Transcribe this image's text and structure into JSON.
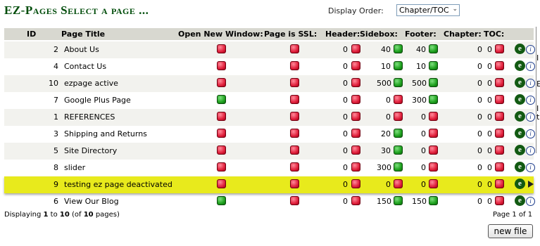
{
  "page_title": "EZ-Pages Select a page ...",
  "display_order": {
    "label": "Display Order:",
    "selected": "Chapter/TOC"
  },
  "columns": {
    "id": "ID",
    "page_title": "Page Title",
    "open_new_window": "Open New Window:",
    "page_is_ssl": "Page is SSL:",
    "header": "Header:",
    "sidebox": "Sidebox:",
    "footer": "Footer:",
    "chapter": "Chapter:",
    "toc": "TOC:"
  },
  "rows": [
    {
      "id": "2",
      "title": "About Us",
      "new_window": "red",
      "ssl": "red",
      "header_val": "0",
      "header": "red",
      "sidebox_val": "40",
      "sidebox": "green",
      "footer_val": "40",
      "footer": "green",
      "chapter": "0",
      "toc_val": "0",
      "toc": "red"
    },
    {
      "id": "4",
      "title": "Contact Us",
      "new_window": "red",
      "ssl": "red",
      "header_val": "0",
      "header": "red",
      "sidebox_val": "10",
      "sidebox": "green",
      "footer_val": "10",
      "footer": "green",
      "chapter": "0",
      "toc_val": "0",
      "toc": "red"
    },
    {
      "id": "10",
      "title": "ezpage active",
      "new_window": "red",
      "ssl": "red",
      "header_val": "0",
      "header": "red",
      "sidebox_val": "500",
      "sidebox": "green",
      "footer_val": "500",
      "footer": "green",
      "chapter": "0",
      "toc_val": "0",
      "toc": "red"
    },
    {
      "id": "7",
      "title": "Google Plus Page",
      "new_window": "green",
      "ssl": "red",
      "header_val": "0",
      "header": "red",
      "sidebox_val": "0",
      "sidebox": "red",
      "footer_val": "300",
      "footer": "green",
      "chapter": "0",
      "toc_val": "0",
      "toc": "red"
    },
    {
      "id": "1",
      "title": "REFERENCES",
      "new_window": "red",
      "ssl": "red",
      "header_val": "0",
      "header": "red",
      "sidebox_val": "0",
      "sidebox": "red",
      "footer_val": "0",
      "footer": "red",
      "chapter": "0",
      "toc_val": "0",
      "toc": "red"
    },
    {
      "id": "3",
      "title": "Shipping and Returns",
      "new_window": "red",
      "ssl": "red",
      "header_val": "0",
      "header": "red",
      "sidebox_val": "20",
      "sidebox": "green",
      "footer_val": "0",
      "footer": "red",
      "chapter": "0",
      "toc_val": "0",
      "toc": "red"
    },
    {
      "id": "5",
      "title": "Site Directory",
      "new_window": "red",
      "ssl": "red",
      "header_val": "0",
      "header": "red",
      "sidebox_val": "30",
      "sidebox": "green",
      "footer_val": "0",
      "footer": "red",
      "chapter": "0",
      "toc_val": "0",
      "toc": "red"
    },
    {
      "id": "8",
      "title": "slider",
      "new_window": "red",
      "ssl": "red",
      "header_val": "0",
      "header": "red",
      "sidebox_val": "300",
      "sidebox": "green",
      "footer_val": "0",
      "footer": "red",
      "chapter": "0",
      "toc_val": "0",
      "toc": "red"
    },
    {
      "id": "9",
      "title": "testing ez page deactivated",
      "new_window": "red",
      "ssl": "red",
      "header_val": "0",
      "header": "red",
      "sidebox_val": "0",
      "sidebox": "red",
      "footer_val": "0",
      "footer": "red",
      "chapter": "0",
      "toc_val": "0",
      "toc": "red",
      "selected": true
    },
    {
      "id": "6",
      "title": "View Our Blog",
      "new_window": "green",
      "ssl": "red",
      "header_val": "0",
      "header": "red",
      "sidebox_val": "150",
      "sidebox": "green",
      "footer_val": "150",
      "footer": "green",
      "chapter": "0",
      "toc_val": "0",
      "toc": "red"
    }
  ],
  "row_actions": {
    "edit_icon": "e",
    "info_icon": "i"
  },
  "right_edge_chars": [
    "I",
    "E",
    "I",
    "t"
  ],
  "footer": {
    "pre": "Displaying ",
    "from": "1",
    "to_text": " to ",
    "to": "10",
    "of_pre": " (of ",
    "total": "10",
    "of_post": " pages)",
    "page_text": "Page 1 of 1"
  },
  "new_file_label": "new file",
  "colors": {
    "title": "#004c0a",
    "header_bg": "#d8d8d0",
    "selected_row": "#e8ea1c",
    "on": "#1ea01e",
    "off": "#e0203c"
  }
}
